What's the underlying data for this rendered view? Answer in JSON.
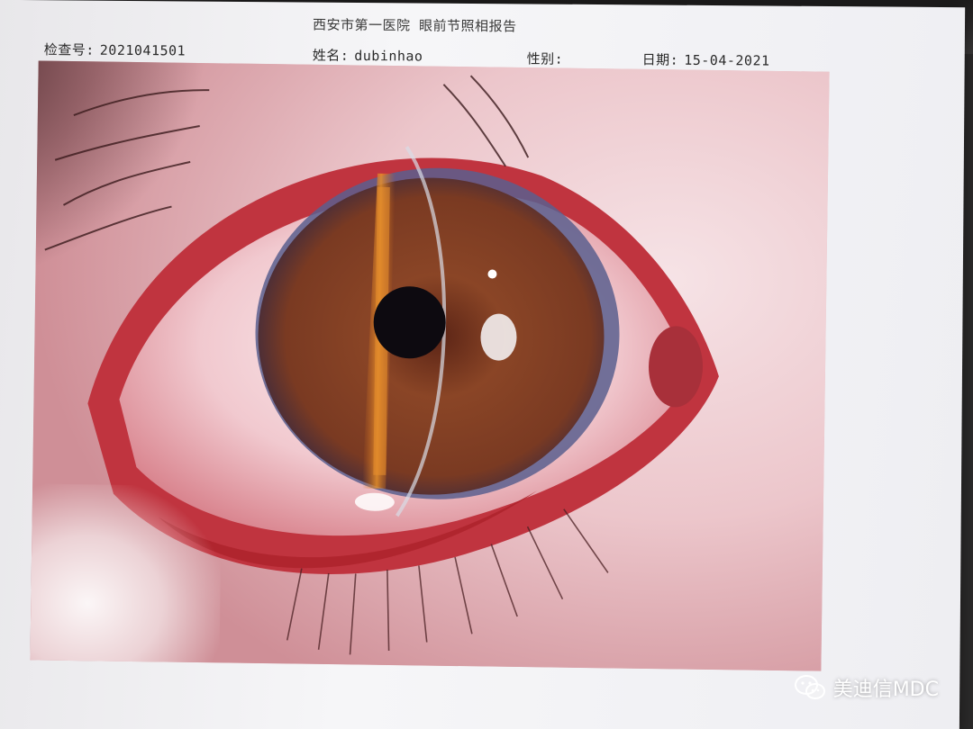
{
  "header": {
    "title": "西安市第一医院 眼前节照相报告",
    "exam_label": "检查号:",
    "exam_number": "2021041501",
    "name_label": "姓名:",
    "name_value": "dubinhao",
    "sex_label": "性别:",
    "sex_value": "",
    "date_label": "日期:",
    "date_value": "15-04-2021"
  },
  "photo": {
    "subject": "slit-lamp photograph of eye",
    "colors": {
      "iris": "#7a3a1e",
      "sclera": "#f3d9dc",
      "conjunctiva": "#c2323c",
      "pupil": "#0d0a10"
    }
  },
  "watermark": {
    "text": "美迪信MDC",
    "icon": "wechat-icon"
  }
}
